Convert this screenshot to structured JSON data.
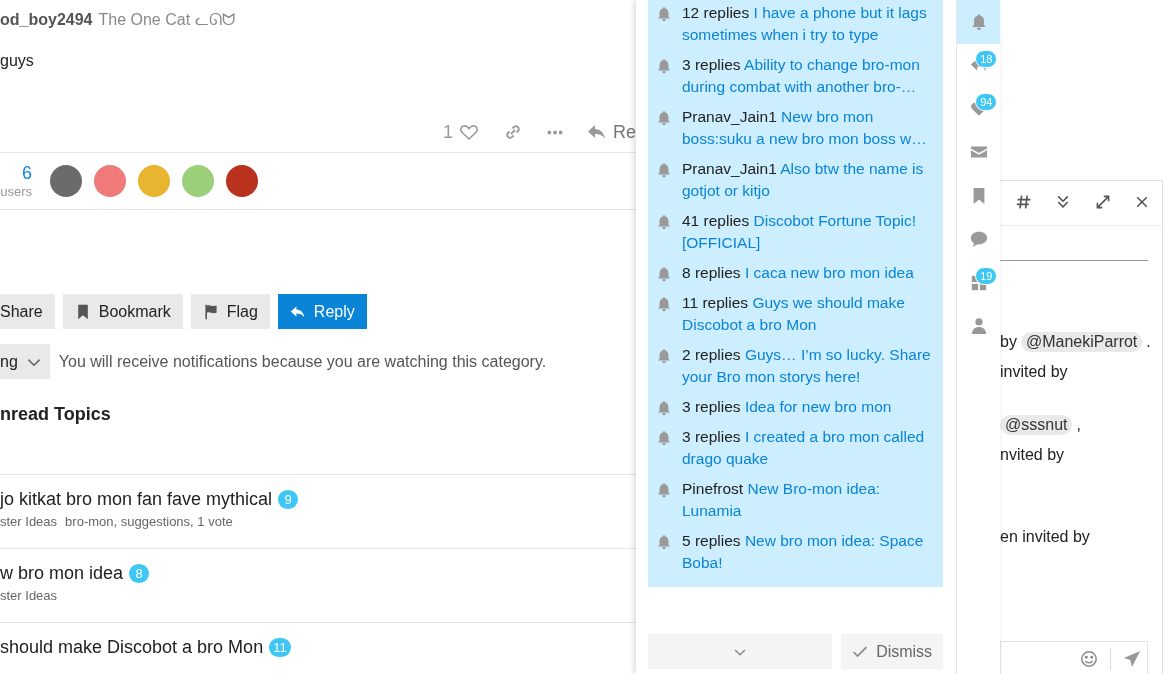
{
  "post": {
    "username": "od_boy2494",
    "user_title": "The One Cat ᓚᘏᗢ",
    "body": "guys",
    "like_count": "1",
    "liked": false,
    "reply_label": "Re"
  },
  "participants": {
    "count": "6",
    "label": "users",
    "avatars": [
      {
        "color": "#6b6b6b"
      },
      {
        "color": "#f07a7a"
      },
      {
        "color": "#e8b530"
      },
      {
        "color": "#9ccf7a"
      },
      {
        "color": "#b8321e"
      }
    ]
  },
  "topic_buttons": [
    {
      "kind": "share",
      "label": "Share"
    },
    {
      "kind": "bookmark",
      "label": "Bookmark"
    },
    {
      "kind": "flag",
      "label": "Flag"
    },
    {
      "kind": "reply",
      "label": "Reply"
    }
  ],
  "notification_level": {
    "label": "ng",
    "description": "You will receive notifications because you are watching this category."
  },
  "suggested": {
    "title": "nread Topics",
    "topics": [
      {
        "title": "jo kitkat bro mon fan fave mythical",
        "badge": "9",
        "category": "ster Ideas",
        "tags": "bro-mon, suggestions, 1 vote"
      },
      {
        "title": "w bro mon idea",
        "badge": "8",
        "category": "ster Ideas"
      },
      {
        "title": " should make Discobot a bro Mon",
        "badge": "11"
      }
    ]
  },
  "user_menu": {
    "notifications": [
      {
        "actor": "12 replies",
        "title": "I have a phone but it lags sometimes when i try to type"
      },
      {
        "actor": "3 replies",
        "title": "Ability to change bro-mon during combat with another bro-…"
      },
      {
        "actor": "Pranav_Jain1",
        "title": "New bro mon boss:suku a new bro mon boss w…"
      },
      {
        "actor": "Pranav_Jain1",
        "title": "Also btw the name is gotjot or kitjo"
      },
      {
        "actor": "41 replies",
        "title": "Discobot Fortune Topic! [OFFICIAL]"
      },
      {
        "actor": "8 replies",
        "title": "I caca new bro mon idea"
      },
      {
        "actor": "11 replies",
        "title": "Guys we should make Discobot a bro Mon"
      },
      {
        "actor": "2 replies",
        "title": "Guys… I’m so lucky. Share your Bro mon storys here!"
      },
      {
        "actor": "3 replies",
        "title": "Idea for new bro mon"
      },
      {
        "actor": "3 replies",
        "title": "I created a bro mon called drago quake"
      },
      {
        "actor": "Pinefrost",
        "title": "New Bro-mon idea: Lunamia"
      },
      {
        "actor": "5 replies",
        "title": "New bro mon idea: Space Boba!"
      }
    ],
    "dismiss": "Dismiss",
    "rail": [
      {
        "kind": "bell",
        "selected": true
      },
      {
        "kind": "reply",
        "selected": false,
        "badge": "18"
      },
      {
        "kind": "heart",
        "selected": false,
        "badge": "94"
      },
      {
        "kind": "mail",
        "selected": false
      },
      {
        "kind": "bookmark",
        "selected": false
      },
      {
        "kind": "chat",
        "selected": false
      },
      {
        "kind": "grid",
        "selected": false,
        "badge": "19"
      },
      {
        "kind": "person",
        "selected": false
      }
    ]
  },
  "chat_drawer": {
    "lines": [
      {
        "text": "by",
        "mention": "@ManekiParrot",
        "after": "."
      },
      {
        "text": "invited by"
      },
      {
        "mention": "@sssnut",
        "after": ","
      },
      {
        "text": "nvited by"
      },
      {
        "text": "en invited by"
      }
    ]
  }
}
